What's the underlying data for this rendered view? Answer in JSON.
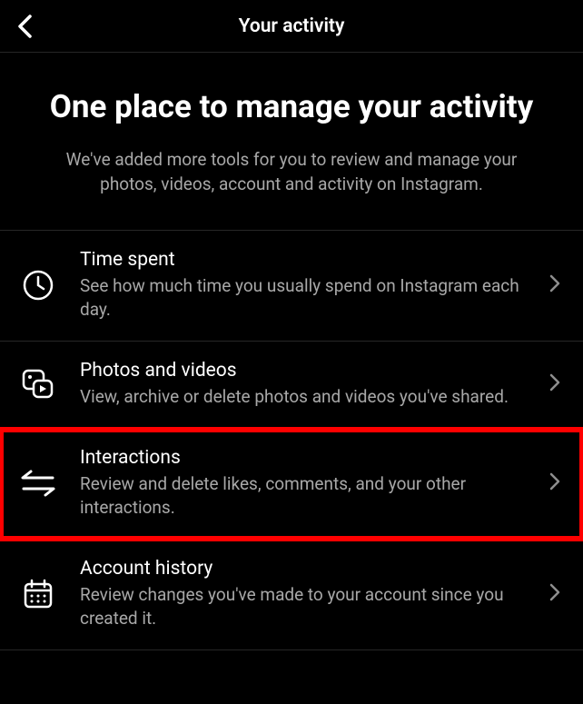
{
  "header": {
    "title": "Your activity"
  },
  "intro": {
    "heading": "One place to manage your activity",
    "subtitle": "We've added more tools for you to review and manage your photos, videos, account and activity on Instagram."
  },
  "items": [
    {
      "icon": "clock-icon",
      "title": "Time spent",
      "desc": "See how much time you usually spend on Instagram each day.",
      "highlighted": false
    },
    {
      "icon": "photos-videos-icon",
      "title": "Photos and videos",
      "desc": "View, archive or delete photos and videos you've shared.",
      "highlighted": false
    },
    {
      "icon": "interactions-icon",
      "title": "Interactions",
      "desc": "Review and delete likes, comments, and your other interactions.",
      "highlighted": true
    },
    {
      "icon": "calendar-icon",
      "title": "Account history",
      "desc": "Review changes you've made to your account since you created it.",
      "highlighted": false
    }
  ]
}
